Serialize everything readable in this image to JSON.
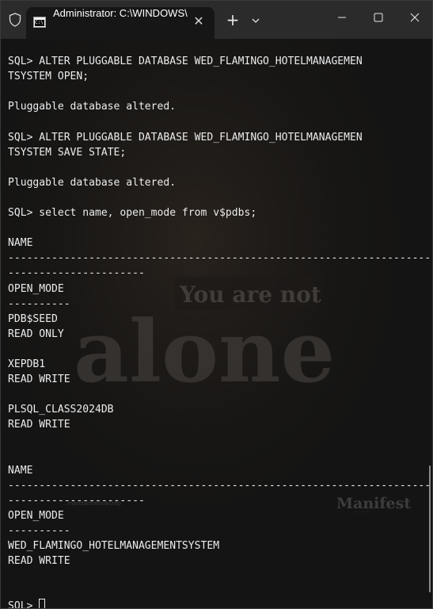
{
  "window": {
    "tab_title": "Administrator: C:\\WINDOWS\\",
    "tab_icon": "command-prompt-icon",
    "tab_icon_text": "C:\\",
    "controls": [
      "minimize-icon",
      "maximize-icon",
      "close-icon"
    ]
  },
  "terminal": {
    "lines": [
      "",
      "SQL> ALTER PLUGGABLE DATABASE WED_FLAMINGO_HOTELMANAGEMEN",
      "TSYSTEM OPEN;",
      "",
      "Pluggable database altered.",
      "",
      "SQL> ALTER PLUGGABLE DATABASE WED_FLAMINGO_HOTELMANAGEMEN",
      "TSYSTEM SAVE STATE;",
      "",
      "Pluggable database altered.",
      "",
      "SQL> select name, open_mode from v$pdbs;",
      "",
      "NAME",
      "--------------------------------------------------------------------------------",
      "----------------------",
      "OPEN_MODE",
      "----------",
      "PDB$SEED",
      "READ ONLY",
      "",
      "XEPDB1",
      "READ WRITE",
      "",
      "PLSQL_CLASS2024DB",
      "READ WRITE",
      "",
      "",
      "NAME",
      "--------------------------------------------------------------------------------",
      "----------------------",
      "OPEN_MODE",
      "----------",
      "WED_FLAMINGO_HOTELMANAGEMENTSYSTEM",
      "READ WRITE",
      "",
      "",
      "SQL> "
    ],
    "background_art": {
      "headline": "You are not",
      "big_word": "alone",
      "caption": "...mandantfeliowstep",
      "brand": "Manifest",
      "brand_sub": "— — — —"
    },
    "colors": {
      "text": "#ececec",
      "background": "#141414",
      "titlebar": "#2b2b2b"
    }
  }
}
